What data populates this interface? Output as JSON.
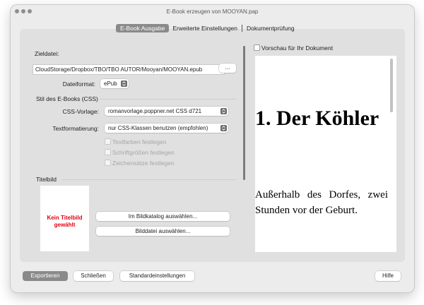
{
  "window": {
    "title": "E-Book erzeugen von MOOYAN.pap"
  },
  "tabs": [
    {
      "label": "E-Book Ausgabe",
      "selected": true
    },
    {
      "label": "Erweiterte Einstellungen",
      "selected": false
    },
    {
      "label": "Dokumentprüfung",
      "selected": false
    }
  ],
  "target": {
    "label": "Zieldatei:",
    "path": "CloudStorage/Dropbox/TBO/TBO AUTOR/Mooyan/MOOYAN.epub",
    "browse_label": "...",
    "format_label": "Dateiformat:",
    "format_value": "ePub"
  },
  "style": {
    "section_label": "Stil des E-Books (CSS)",
    "css_template_label": "CSS-Vorlage:",
    "css_template_value": "romanvorlage.poppner.net CSS d721",
    "text_format_label": "Textformatierung:",
    "text_format_value": "nur CSS-Klassen benutzen (empfohlen)",
    "options": [
      {
        "label": "Textfarben festlegen",
        "checked": false,
        "enabled": false
      },
      {
        "label": "Schriftgrößen festlegen",
        "checked": false,
        "enabled": false
      },
      {
        "label": "Zeichensätze festlegen",
        "checked": false,
        "enabled": false
      }
    ]
  },
  "cover": {
    "section_label": "Titelbild",
    "placeholder": "Kein Titelbild gewählt",
    "catalog_button": "Im Bildkatalog auswählen...",
    "file_button": "Bilddatei auswählen..."
  },
  "preview": {
    "checkbox_label": "Vorschau für Ihr Dokument",
    "checked": false,
    "heading": "1. Der Köhler",
    "paragraph": "Außerhalb des Dorfes, zwei Stunden vor der Geburt."
  },
  "footer": {
    "export_label": "Exportieren",
    "close_label": "Schließen",
    "defaults_label": "Standardeinstellungen",
    "help_label": "Hilfe"
  },
  "colors": {
    "primary_button": "#8a8a8a",
    "no_cover_text": "#e0000f"
  }
}
